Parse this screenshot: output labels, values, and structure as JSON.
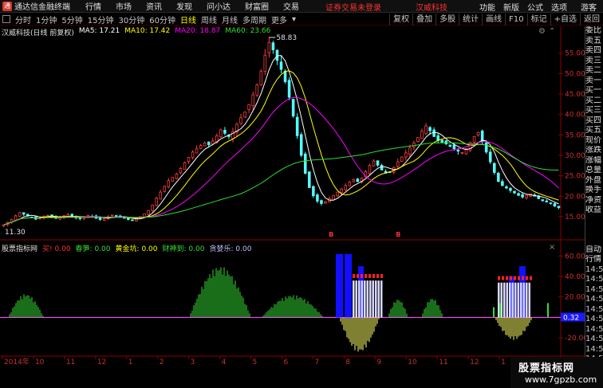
{
  "titlebar": {
    "app_title": "通达信金融终端",
    "menu": [
      "行情",
      "市场",
      "资讯",
      "发现",
      "问小达",
      "财富圈",
      "交易"
    ],
    "login_notice": "证券交易未登录",
    "stock_title": "汉威科技",
    "right_menu": [
      "功能",
      "新版",
      "公式",
      "选项"
    ],
    "guest": "游客"
  },
  "periodbar": {
    "periods": [
      "分时",
      "1分钟",
      "5分钟",
      "15分钟",
      "30分钟",
      "60分钟",
      "日线",
      "周线",
      "月线",
      "多周期",
      "更多"
    ],
    "active": "日线",
    "tools": [
      "复权",
      "叠加",
      "多股",
      "统计",
      "画线",
      "F10",
      "标记",
      "+自选",
      "返回"
    ]
  },
  "main_info": {
    "stock": "汉威科技(日线 前复权)",
    "ma5": "MA5: 17.21",
    "ma10": "MA10: 17.42",
    "ma20": "MA20: 18.87",
    "ma60": "MA60: 23.66"
  },
  "sub_info": {
    "name": "股票指标网",
    "items": [
      {
        "label": "买!",
        "value": "0.00",
        "color": "#ff3030"
      },
      {
        "label": "春笋:",
        "value": "0.00",
        "color": "#33dd33"
      },
      {
        "label": "黄金坑:",
        "value": "0.00",
        "color": "#ffff00"
      },
      {
        "label": "财神到:",
        "value": "0.00",
        "color": "#33dd33"
      },
      {
        "label": "贪婪乐:",
        "value": "0.00",
        "color": "#c0c0ff"
      }
    ]
  },
  "sidepanel": {
    "top": [
      "委比",
      "卖五",
      "卖四",
      "卖三",
      "卖二",
      "卖一",
      "买一",
      "买二",
      "买三",
      "买四",
      "买五",
      "现价",
      "涨跌",
      "涨幅",
      "总量",
      "外盘",
      "换手",
      "净资",
      "收益"
    ],
    "bottom": [
      "自动",
      "行情",
      "14:50",
      "14:50",
      "14:50",
      "14:50",
      "14:50",
      "14:50",
      "14:50",
      "14:50",
      "14:50",
      "14:50",
      "14:50"
    ]
  },
  "watermark": {
    "title": "股票指标网",
    "url": "www.7gpzb.com"
  },
  "chart_data": [
    {
      "type": "candlestick",
      "title": "汉威科技(日线 前复权)",
      "y_ticks": [
        15.0,
        20.0,
        25.0,
        30.0,
        35.0,
        40.0,
        45.0,
        50.0,
        55.0
      ],
      "ylim": [
        10.5,
        60
      ],
      "annotations": [
        {
          "text": "58.83",
          "kind": "high"
        },
        {
          "text": "11.30",
          "kind": "low"
        }
      ],
      "x_ticks": [
        "2014年",
        "10",
        "11",
        "12",
        "1",
        "2",
        "3",
        "4",
        "5",
        "6",
        "7",
        "8",
        "9",
        "10",
        "11",
        "12",
        "1",
        "2"
      ],
      "close_series": [
        13.0,
        13.6,
        14.3,
        15.2,
        16.0,
        15.6,
        15.1,
        14.8,
        14.4,
        14.7,
        15.1,
        15.3,
        15.0,
        14.6,
        14.8,
        15.2,
        15.5,
        15.1,
        14.7,
        14.5,
        14.9,
        15.3,
        15.0,
        14.6,
        14.3,
        14.5,
        15.0,
        15.4,
        15.2,
        14.8,
        14.6,
        14.3,
        14.1,
        14.4,
        15.0,
        15.7,
        16.5,
        17.8,
        19.5,
        21.0,
        22.4,
        23.8,
        24.6,
        25.4,
        26.8,
        28.2,
        29.5,
        30.8,
        31.6,
        32.4,
        33.0,
        32.6,
        33.5,
        34.8,
        36.2,
        35.4,
        34.6,
        35.8,
        37.6,
        39.2,
        40.6,
        42.4,
        44.8,
        47.2,
        50.6,
        54.5,
        57.6,
        55.8,
        53.2,
        51.0,
        48.0,
        44.2,
        39.6,
        34.8,
        30.0,
        25.6,
        22.1,
        20.1,
        18.8,
        18.2,
        18.6,
        19.4,
        20.2,
        21.0,
        21.8,
        22.6,
        23.4,
        24.0,
        23.6,
        24.4,
        26.0,
        27.5,
        28.6,
        27.6,
        26.4,
        25.6,
        25.9,
        27.0,
        28.4,
        29.6,
        30.6,
        31.8,
        33.0,
        34.4,
        35.9,
        37.2,
        36.0,
        34.6,
        33.6,
        33.2,
        32.8,
        32.2,
        31.6,
        31.0,
        30.7,
        31.6,
        33.2,
        34.6,
        35.6,
        33.4,
        30.8,
        28.4,
        25.8,
        23.6,
        22.6,
        22.0,
        21.4,
        20.8,
        20.2,
        19.8,
        20.2,
        20.6,
        20.0,
        19.4,
        18.9,
        18.6,
        18.2,
        17.6,
        17.2
      ],
      "signals": [
        {
          "text": "B"
        },
        {
          "text": "B"
        }
      ]
    },
    {
      "type": "bar",
      "title": "股票指标网",
      "y_ticks": [
        60.0,
        40.0,
        20.0,
        -20.0
      ],
      "ylim": [
        -37,
        68
      ],
      "current_value": "0.32"
    }
  ]
}
